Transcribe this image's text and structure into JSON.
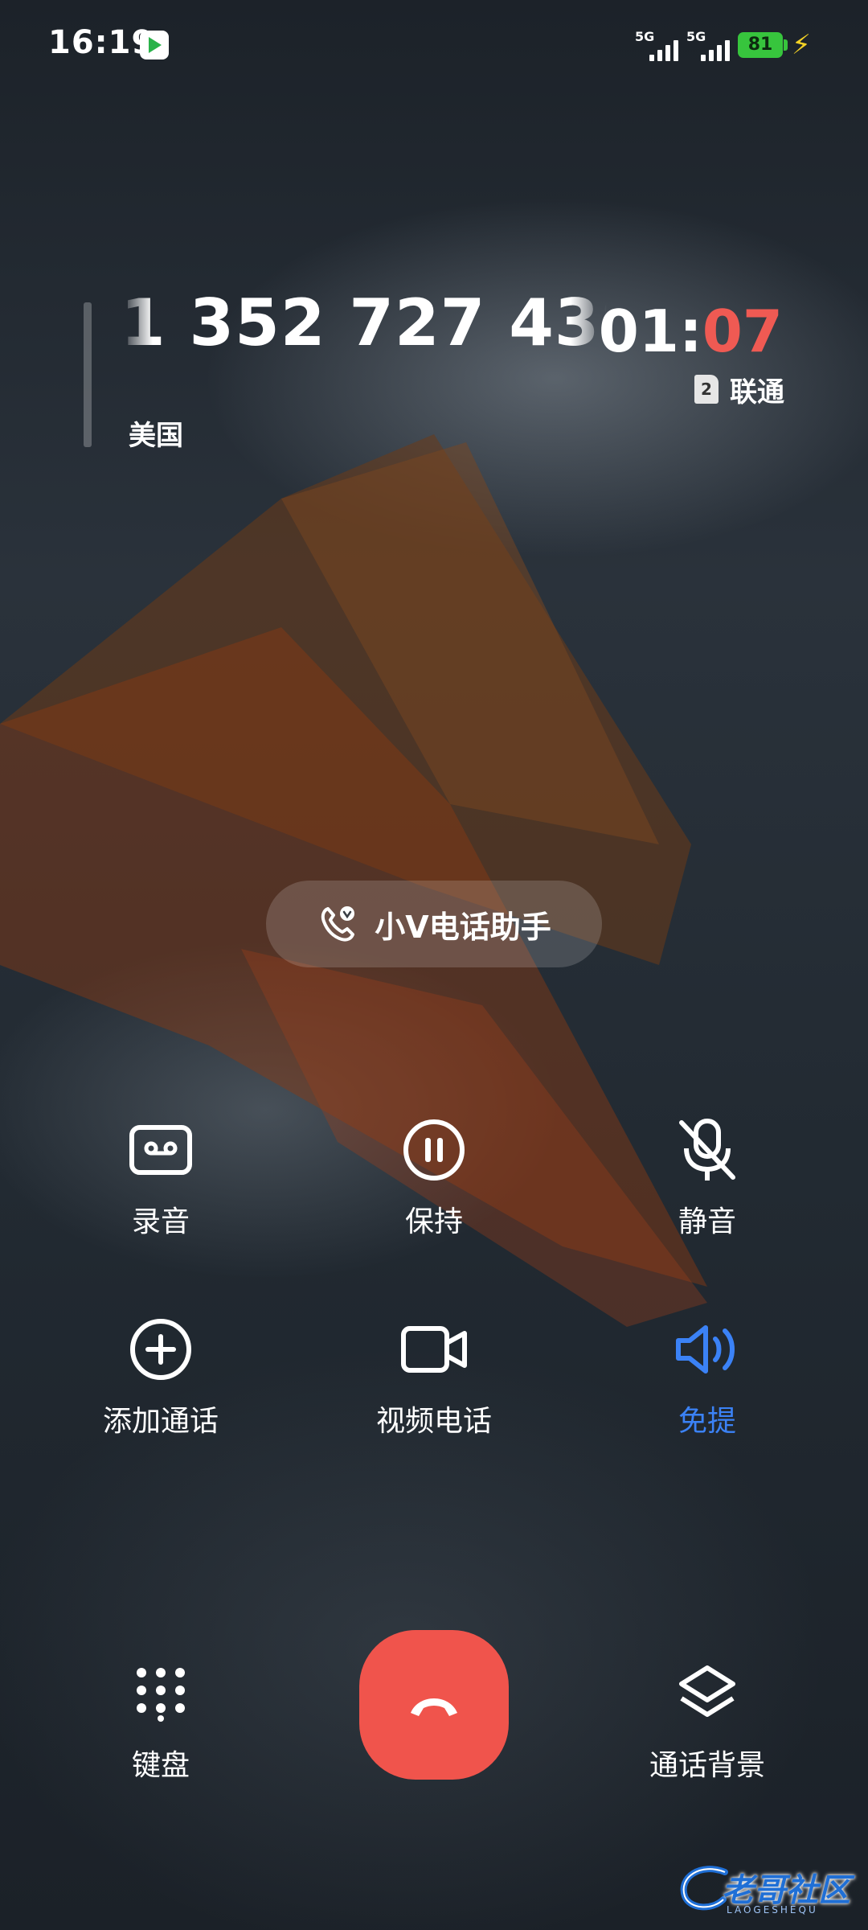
{
  "status_bar": {
    "time": "16:19",
    "app_icon": "video-app-icon",
    "signal1_label": "5G",
    "signal2_label": "5G",
    "battery_level": "81",
    "charging_icon": "bolt-icon"
  },
  "call": {
    "number": "1 352 727 4385",
    "location": "美国",
    "timer_main": "01:",
    "timer_seconds": "07",
    "sim_slot": "2",
    "carrier": "联通"
  },
  "assistant": {
    "label": "小V电话助手",
    "icon": "phone-assistant-icon"
  },
  "controls": [
    {
      "label": "录音",
      "icon": "record-icon"
    },
    {
      "label": "保持",
      "icon": "pause-icon"
    },
    {
      "label": "静音",
      "icon": "mute-icon"
    },
    {
      "label": "添加通话",
      "icon": "add-call-icon"
    },
    {
      "label": "视频电话",
      "icon": "video-camera-icon"
    },
    {
      "label": "免提",
      "icon": "speaker-icon",
      "active": true
    }
  ],
  "bottom": {
    "keypad_label": "键盘",
    "end_call_icon": "hang-up-icon",
    "background_label": "通话背景"
  },
  "colors": {
    "end_call": "#f0544c",
    "active_control": "#3b82f6",
    "timer_seconds": "#ef5a53",
    "battery": "#37c53d"
  },
  "watermark": {
    "text": "老哥社区",
    "subtext": "LAOGESHEQU"
  }
}
